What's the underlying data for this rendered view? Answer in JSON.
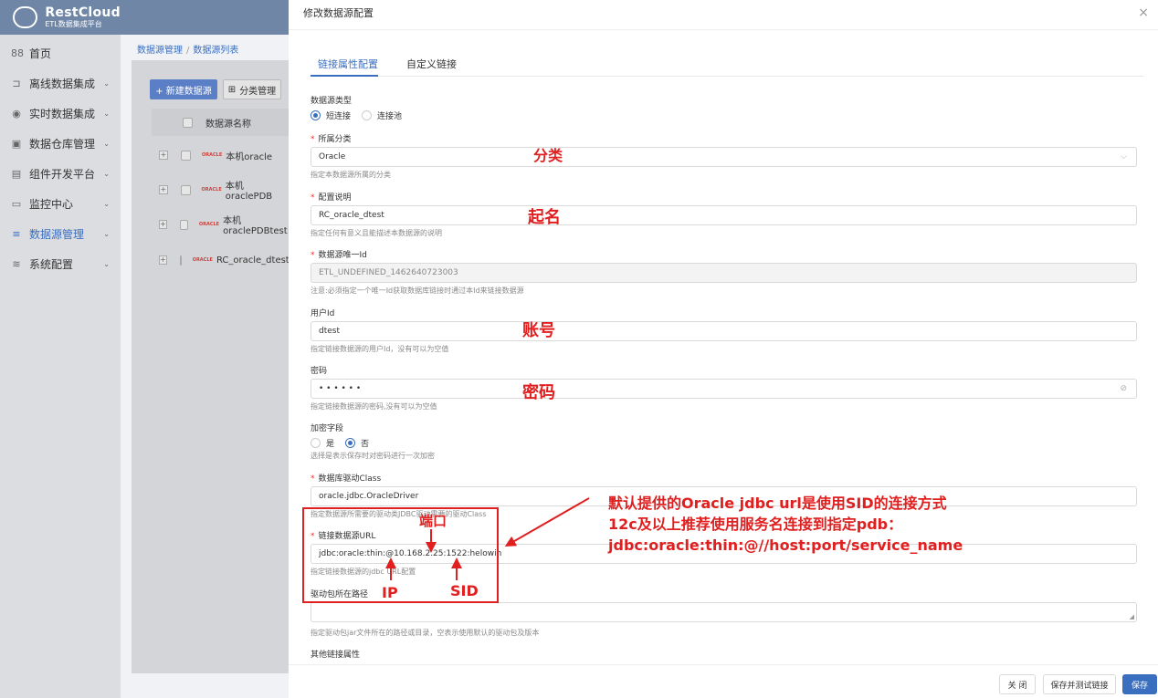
{
  "app": {
    "logo_title": "RestCloud",
    "logo_subtitle": "ETL数据集成平台"
  },
  "sidebar": {
    "items": [
      {
        "icon": "88",
        "label": "首页"
      },
      {
        "icon": "⊐",
        "label": "离线数据集成"
      },
      {
        "icon": "◉",
        "label": "实时数据集成"
      },
      {
        "icon": "▣",
        "label": "数据仓库管理"
      },
      {
        "icon": "▤",
        "label": "组件开发平台"
      },
      {
        "icon": "▭",
        "label": "监控中心"
      },
      {
        "icon": "≡",
        "label": "数据源管理"
      },
      {
        "icon": "≋",
        "label": "系统配置"
      }
    ],
    "active_index": 6
  },
  "background": {
    "breadcrumb": [
      "数据源管理",
      "数据源列表"
    ],
    "new_button": "+ 新建数据源",
    "category_button": "分类管理",
    "table_header": "数据源名称",
    "rows": [
      {
        "tag": "ORACLE",
        "name": "本机oracle"
      },
      {
        "tag": "ORACLE",
        "name": "本机oraclePDB"
      },
      {
        "tag": "ORACLE",
        "name": "本机oraclePDBtest"
      },
      {
        "tag": "ORACLE",
        "name": "RC_oracle_dtest"
      }
    ]
  },
  "dialog": {
    "title": "修改数据源配置",
    "close": "×",
    "tabs": [
      "链接属性配置",
      "自定义链接"
    ],
    "active_tab": 0,
    "fields": {
      "source_type": {
        "label": "数据源类型",
        "options": [
          "短连接",
          "连接池"
        ],
        "selected": 0
      },
      "category": {
        "label": "所属分类",
        "value": "Oracle",
        "help": "指定本数据源所属的分类"
      },
      "config_desc": {
        "label": "配置说明",
        "value": "RC_oracle_dtest",
        "help": "指定任何有意义且能描述本数据源的说明"
      },
      "unique_id": {
        "label": "数据源唯一Id",
        "value": "ETL_UNDEFINED_1462640723003",
        "help": "注意:必须指定一个唯一Id获取数据库链接时通过本Id来链接数据源"
      },
      "user_id": {
        "label": "用户Id",
        "value": "dtest",
        "help": "指定链接数据源的用户Id，没有可以为空值"
      },
      "password": {
        "label": "密码",
        "value": "• • • • • •",
        "suffix": "⊘",
        "help": "指定链接数据源的密码,没有可以为空值"
      },
      "encrypt": {
        "label": "加密字段",
        "options": [
          "是",
          "否"
        ],
        "selected": 1,
        "help": "选择是表示保存时对密码进行一次加密"
      },
      "driver_class": {
        "label": "数据库驱动Class",
        "value": "oracle.jdbc.OracleDriver",
        "help": "指定数据源所需要的驱动类JDBC驱动需要的驱动Class"
      },
      "url": {
        "label": "链接数据源URL",
        "value": "jdbc:oracle:thin:@10.168.2.25:1522:helowin",
        "help": "指定链接数据源的jdbc URL配置"
      },
      "driver_path": {
        "label": "驱动包所在路径",
        "value": "",
        "help": "指定驱动包jar文件所在的路径或目录，空表示使用默认的驱动包及版本"
      },
      "other_props": {
        "label": "其他链接属性"
      }
    },
    "footer": {
      "close": "关 闭",
      "save_test": "保存并测试链接",
      "save": "保存"
    }
  },
  "annotations": {
    "category": "分类",
    "name": "起名",
    "account": "账号",
    "password": "密码",
    "port": "端口",
    "ip": "IP",
    "sid": "SID",
    "note_lines": [
      "默认提供的Oracle jdbc url是使用SID的连接方式",
      "12c及以上推荐使用服务名连接到指定pdb：",
      "jdbc:oracle:thin:@//host:port/service_name"
    ],
    "color": "#e02020"
  },
  "colors": {
    "primary": "#3a6fc0",
    "header": "#6f86a6",
    "required": "#e33333"
  }
}
